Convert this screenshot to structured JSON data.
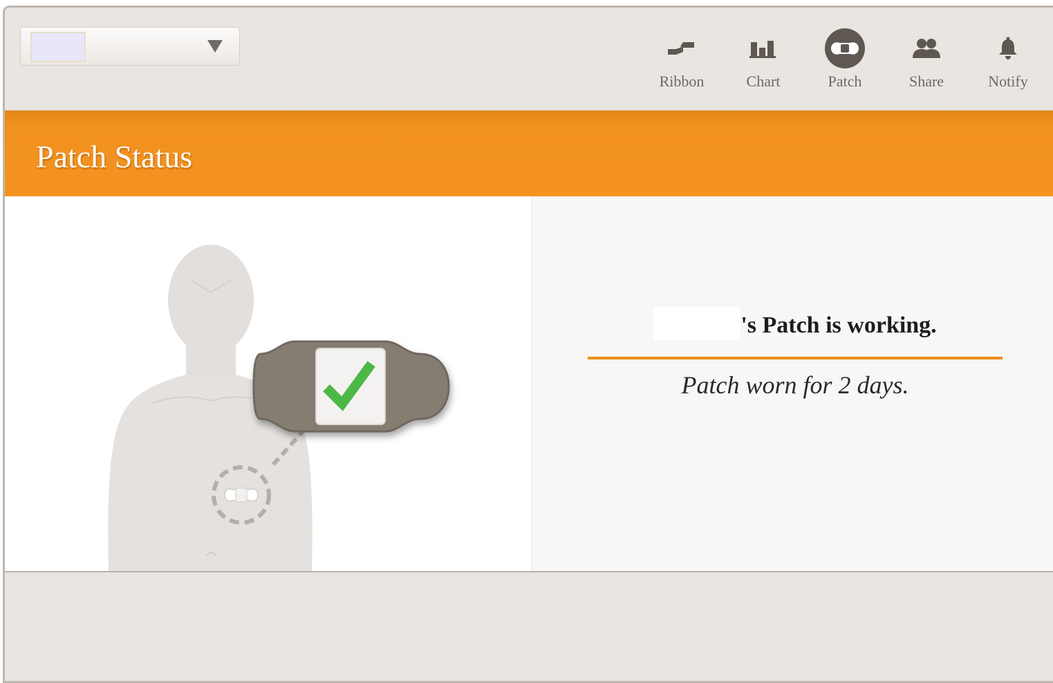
{
  "selector": {
    "icon": "chevron-down-icon"
  },
  "nav": [
    {
      "label": "Ribbon",
      "icon": "ribbon-icon"
    },
    {
      "label": "Chart",
      "icon": "bar-chart-icon"
    },
    {
      "label": "Patch",
      "icon": "patch-icon",
      "active": true
    },
    {
      "label": "Share",
      "icon": "people-icon"
    },
    {
      "label": "Notify",
      "icon": "bell-icon"
    }
  ],
  "banner": {
    "title": "Patch Status"
  },
  "status": {
    "suffix": "'s Patch is working.",
    "detail": "Patch worn for 2 days."
  },
  "colors": {
    "accent": "#f49320",
    "header_bg": "#e9e5e1",
    "icon": "#5f5851",
    "check": "#4cb847"
  }
}
